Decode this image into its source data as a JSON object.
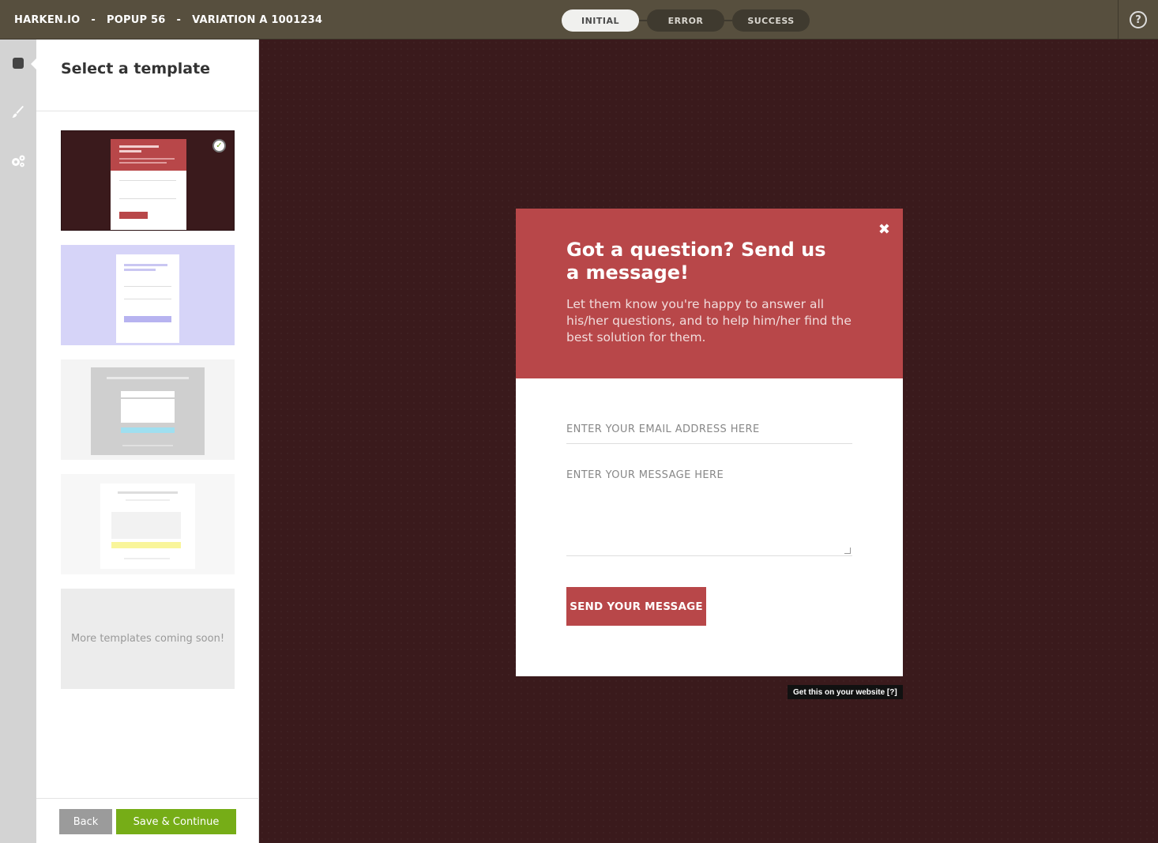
{
  "header": {
    "brand": "HARKEN.IO",
    "popup": "POPUP 56",
    "variation": "VARIATION A 1001234",
    "separator": "-",
    "states": [
      {
        "label": "INITIAL",
        "active": true
      },
      {
        "label": "ERROR",
        "active": false
      },
      {
        "label": "SUCCESS",
        "active": false
      }
    ],
    "help_glyph": "?"
  },
  "rail": {
    "icons": [
      "template-icon",
      "brush-icon",
      "settings-gears-icon"
    ]
  },
  "panel": {
    "title": "Select a template",
    "more_templates": "More templates coming soon!",
    "back_label": "Back",
    "save_label": "Save & Continue",
    "check_glyph": "✓"
  },
  "templates": [
    {
      "name": "red-question",
      "selected": true
    },
    {
      "name": "lavender",
      "selected": false
    },
    {
      "name": "gray-newsletter",
      "selected": false
    },
    {
      "name": "question-talk",
      "selected": false
    }
  ],
  "popup": {
    "close_glyph": "✖",
    "title": "Got a question? Send us a message!",
    "description": "Let them know you're happy to answer all his/her questions, and to help him/her find the best solution for them.",
    "email_placeholder": "ENTER YOUR EMAIL ADDRESS HERE",
    "message_placeholder": "ENTER YOUR MESSAGE HERE",
    "send_label": "SEND YOUR MESSAGE",
    "accent": "#b84749"
  },
  "credit": "Get this on your website [?]",
  "colors": {
    "topbar": "#574f3e",
    "canvas": "#3a1a1c",
    "save": "#76ad17",
    "back": "#9b9b9b"
  }
}
